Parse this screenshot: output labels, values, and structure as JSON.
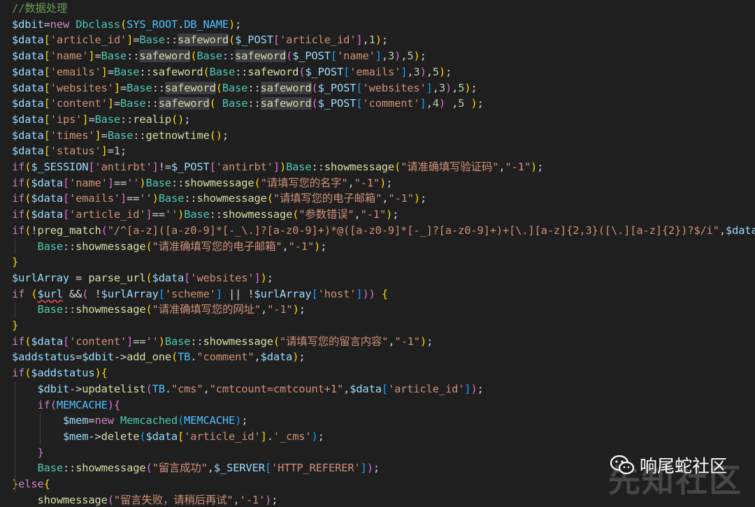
{
  "code_lines": [
    [
      [
        "//数据处理",
        "comment"
      ]
    ],
    [
      [
        "$dbit",
        "var"
      ],
      [
        "=",
        "op"
      ],
      [
        "new ",
        "kw"
      ],
      [
        "Dbclass",
        "class"
      ],
      [
        "(",
        "br1"
      ],
      [
        "SYS_ROOT",
        "const"
      ],
      [
        ".",
        "op"
      ],
      [
        "DB_NAME",
        "const"
      ],
      [
        ")",
        "br1"
      ],
      [
        ";",
        "punc"
      ]
    ],
    [
      [
        "$data",
        "var"
      ],
      [
        "[",
        "br1"
      ],
      [
        "'article_id'",
        "str"
      ],
      [
        "]",
        "br1"
      ],
      [
        "=",
        "op"
      ],
      [
        "Base",
        "class"
      ],
      [
        "::",
        "op"
      ],
      [
        "safeword",
        "fn-hl"
      ],
      [
        "(",
        "br1"
      ],
      [
        "$_POST",
        "var"
      ],
      [
        "[",
        "br2"
      ],
      [
        "'article_id'",
        "str"
      ],
      [
        "]",
        "br2"
      ],
      [
        ",",
        "punc"
      ],
      [
        "1",
        "num"
      ],
      [
        ")",
        "br1"
      ],
      [
        ";",
        "punc"
      ]
    ],
    [
      [
        "$data",
        "var"
      ],
      [
        "[",
        "br1"
      ],
      [
        "'name'",
        "str"
      ],
      [
        "]",
        "br1"
      ],
      [
        "=",
        "op"
      ],
      [
        "Base",
        "class"
      ],
      [
        "::",
        "op"
      ],
      [
        "safeword",
        "fn-hl"
      ],
      [
        "(",
        "br1"
      ],
      [
        "Base",
        "class"
      ],
      [
        "::",
        "op"
      ],
      [
        "safeword",
        "fn-hl"
      ],
      [
        "(",
        "br2"
      ],
      [
        "$_POST",
        "var"
      ],
      [
        "[",
        "br3"
      ],
      [
        "'name'",
        "str"
      ],
      [
        "]",
        "br3"
      ],
      [
        ",",
        "punc"
      ],
      [
        "3",
        "num"
      ],
      [
        ")",
        "br2"
      ],
      [
        ",",
        "punc"
      ],
      [
        "5",
        "num"
      ],
      [
        ")",
        "br1"
      ],
      [
        ";",
        "punc"
      ]
    ],
    [
      [
        "$data",
        "var"
      ],
      [
        "[",
        "br1"
      ],
      [
        "'emails'",
        "str"
      ],
      [
        "]",
        "br1"
      ],
      [
        "=",
        "op"
      ],
      [
        "Base",
        "class"
      ],
      [
        "::",
        "op"
      ],
      [
        "safeword",
        "fn"
      ],
      [
        "(",
        "br1"
      ],
      [
        "Base",
        "class"
      ],
      [
        "::",
        "op"
      ],
      [
        "safeword",
        "fn"
      ],
      [
        "(",
        "br2"
      ],
      [
        "$_POST",
        "var"
      ],
      [
        "[",
        "br3"
      ],
      [
        "'emails'",
        "str"
      ],
      [
        "]",
        "br3"
      ],
      [
        ",",
        "punc"
      ],
      [
        "3",
        "num"
      ],
      [
        ")",
        "br2"
      ],
      [
        ",",
        "punc"
      ],
      [
        "5",
        "num"
      ],
      [
        ")",
        "br1"
      ],
      [
        ";",
        "punc"
      ]
    ],
    [
      [
        "$data",
        "var"
      ],
      [
        "[",
        "br1"
      ],
      [
        "'websites'",
        "str"
      ],
      [
        "]",
        "br1"
      ],
      [
        "=",
        "op"
      ],
      [
        "Base",
        "class"
      ],
      [
        "::",
        "op"
      ],
      [
        "safeword",
        "fn-hl"
      ],
      [
        "(",
        "br1"
      ],
      [
        "Base",
        "class"
      ],
      [
        "::",
        "op"
      ],
      [
        "safeword",
        "fn-hl"
      ],
      [
        "(",
        "br2"
      ],
      [
        "$_POST",
        "var"
      ],
      [
        "[",
        "br3"
      ],
      [
        "'websites'",
        "str"
      ],
      [
        "]",
        "br3"
      ],
      [
        ",",
        "punc"
      ],
      [
        "3",
        "num"
      ],
      [
        ")",
        "br2"
      ],
      [
        ",",
        "punc"
      ],
      [
        "5",
        "num"
      ],
      [
        ")",
        "br1"
      ],
      [
        ";",
        "punc"
      ]
    ],
    [
      [
        "$data",
        "var"
      ],
      [
        "[",
        "br1"
      ],
      [
        "'content'",
        "str"
      ],
      [
        "]",
        "br1"
      ],
      [
        "=",
        "op"
      ],
      [
        "Base",
        "class"
      ],
      [
        "::",
        "op"
      ],
      [
        "safeword",
        "fn-hl"
      ],
      [
        "(",
        "br1"
      ],
      [
        " ",
        "op"
      ],
      [
        "Base",
        "class"
      ],
      [
        "::",
        "op"
      ],
      [
        "safeword",
        "fn-hl"
      ],
      [
        "(",
        "br2"
      ],
      [
        "$_POST",
        "var"
      ],
      [
        "[",
        "br3"
      ],
      [
        "'comment'",
        "str"
      ],
      [
        "]",
        "br3"
      ],
      [
        ",",
        "punc"
      ],
      [
        "4",
        "num"
      ],
      [
        ")",
        "br2"
      ],
      [
        " ,",
        "punc"
      ],
      [
        "5",
        "num"
      ],
      [
        " ",
        "op"
      ],
      [
        ")",
        "br1"
      ],
      [
        ";",
        "punc"
      ]
    ],
    [
      [
        "$data",
        "var"
      ],
      [
        "[",
        "br1"
      ],
      [
        "'ips'",
        "str"
      ],
      [
        "]",
        "br1"
      ],
      [
        "=",
        "op"
      ],
      [
        "Base",
        "class"
      ],
      [
        "::",
        "op"
      ],
      [
        "realip",
        "fn"
      ],
      [
        "()",
        "br1"
      ],
      [
        ";",
        "punc"
      ]
    ],
    [
      [
        "$data",
        "var"
      ],
      [
        "[",
        "br1"
      ],
      [
        "'times'",
        "str"
      ],
      [
        "]",
        "br1"
      ],
      [
        "=",
        "op"
      ],
      [
        "Base",
        "class"
      ],
      [
        "::",
        "op"
      ],
      [
        "getnowtime",
        "fn"
      ],
      [
        "()",
        "br1"
      ],
      [
        ";",
        "punc"
      ]
    ],
    [
      [
        "$data",
        "var"
      ],
      [
        "[",
        "br1"
      ],
      [
        "'status'",
        "str"
      ],
      [
        "]",
        "br1"
      ],
      [
        "=",
        "op"
      ],
      [
        "1",
        "num"
      ],
      [
        ";",
        "punc"
      ]
    ],
    [
      [
        "if",
        "ctrl"
      ],
      [
        "(",
        "br1"
      ],
      [
        "$_SESSION",
        "var"
      ],
      [
        "[",
        "br2"
      ],
      [
        "'antirbt'",
        "str"
      ],
      [
        "]",
        "br2"
      ],
      [
        "!=",
        "op"
      ],
      [
        "$_POST",
        "var"
      ],
      [
        "[",
        "br2"
      ],
      [
        "'antirbt'",
        "str"
      ],
      [
        "]",
        "br2"
      ],
      [
        ")",
        "br1"
      ],
      [
        "Base",
        "class"
      ],
      [
        "::",
        "op"
      ],
      [
        "showmessage",
        "fn"
      ],
      [
        "(",
        "br1"
      ],
      [
        "\"请准确填写验证码\"",
        "str"
      ],
      [
        ",",
        "punc"
      ],
      [
        "\"-1\"",
        "str"
      ],
      [
        ")",
        "br1"
      ],
      [
        ";",
        "punc"
      ]
    ],
    [
      [
        "if",
        "ctrl"
      ],
      [
        "(",
        "br1"
      ],
      [
        "$data",
        "var"
      ],
      [
        "[",
        "br2"
      ],
      [
        "'name'",
        "str"
      ],
      [
        "]",
        "br2"
      ],
      [
        "==",
        "op"
      ],
      [
        "''",
        "str"
      ],
      [
        ")",
        "br1"
      ],
      [
        "Base",
        "class"
      ],
      [
        "::",
        "op"
      ],
      [
        "showmessage",
        "fn"
      ],
      [
        "(",
        "br1"
      ],
      [
        "\"请填写您的名字\"",
        "str"
      ],
      [
        ",",
        "punc"
      ],
      [
        "\"-1\"",
        "str"
      ],
      [
        ")",
        "br1"
      ],
      [
        ";",
        "punc"
      ]
    ],
    [
      [
        "if",
        "ctrl"
      ],
      [
        "(",
        "br1"
      ],
      [
        "$data",
        "var"
      ],
      [
        "[",
        "br2"
      ],
      [
        "'emails'",
        "str"
      ],
      [
        "]",
        "br2"
      ],
      [
        "==",
        "op"
      ],
      [
        "''",
        "str"
      ],
      [
        ")",
        "br1"
      ],
      [
        "Base",
        "class"
      ],
      [
        "::",
        "op"
      ],
      [
        "showmessage",
        "fn"
      ],
      [
        "(",
        "br1"
      ],
      [
        "\"请填写您的电子邮箱\"",
        "str"
      ],
      [
        ",",
        "punc"
      ],
      [
        "\"-1\"",
        "str"
      ],
      [
        ")",
        "br1"
      ],
      [
        ";",
        "punc"
      ]
    ],
    [
      [
        "if",
        "ctrl"
      ],
      [
        "(",
        "br1"
      ],
      [
        "$data",
        "var"
      ],
      [
        "[",
        "br2"
      ],
      [
        "'article_id'",
        "str"
      ],
      [
        "]",
        "br2"
      ],
      [
        "==",
        "op"
      ],
      [
        "''",
        "str"
      ],
      [
        ")",
        "br1"
      ],
      [
        "Base",
        "class"
      ],
      [
        "::",
        "op"
      ],
      [
        "showmessage",
        "fn"
      ],
      [
        "(",
        "br1"
      ],
      [
        "\"参数错误\"",
        "str"
      ],
      [
        ",",
        "punc"
      ],
      [
        "\"-1\"",
        "str"
      ],
      [
        ")",
        "br1"
      ],
      [
        ";",
        "punc"
      ]
    ],
    [
      [
        "if",
        "ctrl"
      ],
      [
        "(",
        "br1"
      ],
      [
        "!",
        "op"
      ],
      [
        "preg_match",
        "fn"
      ],
      [
        "(",
        "br2"
      ],
      [
        "\"/^[a-z]([a-z0-9]*[-_\\.]?[a-z0-9]+)*@([a-z0-9]*[-_]?[a-z0-9]+)+[\\.][a-z]{2,3}([\\.][a-z]{2})?$/i\"",
        "str"
      ],
      [
        ",",
        "punc"
      ],
      [
        "$data",
        "var"
      ]
    ],
    [
      [
        "    ",
        "op"
      ],
      [
        "Base",
        "class"
      ],
      [
        "::",
        "op"
      ],
      [
        "showmessage",
        "fn"
      ],
      [
        "(",
        "br1"
      ],
      [
        "\"请准确填写您的电子邮箱\"",
        "str"
      ],
      [
        ",",
        "punc"
      ],
      [
        "\"-1\"",
        "str"
      ],
      [
        ")",
        "br1"
      ],
      [
        ";",
        "punc"
      ]
    ],
    [
      [
        "}",
        "br1"
      ]
    ],
    [
      [
        "$urlArray",
        "var"
      ],
      [
        " = ",
        "op"
      ],
      [
        "parse_url",
        "fn"
      ],
      [
        "(",
        "br1"
      ],
      [
        "$data",
        "var"
      ],
      [
        "[",
        "br2"
      ],
      [
        "'websites'",
        "str"
      ],
      [
        "]",
        "br2"
      ],
      [
        ")",
        "br1"
      ],
      [
        ";",
        "punc"
      ]
    ],
    [
      [
        "if",
        "ctrl"
      ],
      [
        " (",
        "br1"
      ],
      [
        "$url",
        "var-sq"
      ],
      [
        " &&",
        "op"
      ],
      [
        "( ",
        "br2"
      ],
      [
        "!",
        "op"
      ],
      [
        "$urlArray",
        "var"
      ],
      [
        "[",
        "br3"
      ],
      [
        "'scheme'",
        "str"
      ],
      [
        "]",
        "br3"
      ],
      [
        " || ",
        "op"
      ],
      [
        "!",
        "op"
      ],
      [
        "$urlArray",
        "var"
      ],
      [
        "[",
        "br3"
      ],
      [
        "'host'",
        "str"
      ],
      [
        "]",
        "br3"
      ],
      [
        "))",
        "br2"
      ],
      [
        " {",
        "br1"
      ]
    ],
    [
      [
        "    ",
        "op"
      ],
      [
        "Base",
        "class"
      ],
      [
        "::",
        "op"
      ],
      [
        "showmessage",
        "fn"
      ],
      [
        "(",
        "br1"
      ],
      [
        "\"请准确填写您的网址\"",
        "str"
      ],
      [
        ",",
        "punc"
      ],
      [
        "\"-1\"",
        "str"
      ],
      [
        ")",
        "br1"
      ],
      [
        ";",
        "punc"
      ]
    ],
    [
      [
        "}",
        "br1"
      ]
    ],
    [
      [
        "if",
        "ctrl"
      ],
      [
        "(",
        "br1"
      ],
      [
        "$data",
        "var"
      ],
      [
        "[",
        "br2"
      ],
      [
        "'content'",
        "str"
      ],
      [
        "]",
        "br2"
      ],
      [
        "==",
        "op"
      ],
      [
        "''",
        "str"
      ],
      [
        ")",
        "br1"
      ],
      [
        "Base",
        "class"
      ],
      [
        "::",
        "op"
      ],
      [
        "showmessage",
        "fn"
      ],
      [
        "(",
        "br1"
      ],
      [
        "\"请填写您的留言内容\"",
        "str"
      ],
      [
        ",",
        "punc"
      ],
      [
        "\"-1\"",
        "str"
      ],
      [
        ")",
        "br1"
      ],
      [
        ";",
        "punc"
      ]
    ],
    [
      [
        "$addstatus",
        "var"
      ],
      [
        "=",
        "op"
      ],
      [
        "$dbit",
        "var"
      ],
      [
        "->",
        "op"
      ],
      [
        "add_one",
        "fn"
      ],
      [
        "(",
        "br1"
      ],
      [
        "TB",
        "const"
      ],
      [
        ".",
        "op"
      ],
      [
        "\"comment\"",
        "str"
      ],
      [
        ",",
        "punc"
      ],
      [
        "$data",
        "var"
      ],
      [
        ")",
        "br1"
      ],
      [
        ";",
        "punc"
      ]
    ],
    [
      [
        "if",
        "ctrl"
      ],
      [
        "(",
        "br1"
      ],
      [
        "$addstatus",
        "var"
      ],
      [
        ")",
        "br1"
      ],
      [
        "{",
        "br1"
      ]
    ],
    [
      [
        "    ",
        "op"
      ],
      [
        "$dbit",
        "var"
      ],
      [
        "->",
        "op"
      ],
      [
        "updatelist",
        "fn"
      ],
      [
        "(",
        "br2"
      ],
      [
        "TB",
        "const"
      ],
      [
        ".",
        "op"
      ],
      [
        "\"cms\"",
        "str"
      ],
      [
        ",",
        "punc"
      ],
      [
        "\"cmtcount=cmtcount+1\"",
        "str"
      ],
      [
        ",",
        "punc"
      ],
      [
        "$data",
        "var"
      ],
      [
        "[",
        "br3"
      ],
      [
        "'article_id'",
        "str"
      ],
      [
        "]",
        "br3"
      ],
      [
        ")",
        "br2"
      ],
      [
        ";",
        "punc"
      ]
    ],
    [
      [
        "    ",
        "op"
      ],
      [
        "if",
        "ctrl"
      ],
      [
        "(",
        "br2"
      ],
      [
        "MEMCACHE",
        "const"
      ],
      [
        ")",
        "br2"
      ],
      [
        "{",
        "br2"
      ]
    ],
    [
      [
        "        ",
        "op"
      ],
      [
        "$mem",
        "var"
      ],
      [
        "=",
        "op"
      ],
      [
        "new ",
        "kw"
      ],
      [
        "Memcached",
        "class"
      ],
      [
        "(",
        "br3"
      ],
      [
        "MEMCACHE",
        "const"
      ],
      [
        ")",
        "br3"
      ],
      [
        ";",
        "punc"
      ]
    ],
    [
      [
        "        ",
        "op"
      ],
      [
        "$mem",
        "var"
      ],
      [
        "->",
        "op"
      ],
      [
        "delete",
        "fn"
      ],
      [
        "(",
        "br3"
      ],
      [
        "$data",
        "var"
      ],
      [
        "[",
        "br1"
      ],
      [
        "'article_id'",
        "str"
      ],
      [
        "]",
        "br1"
      ],
      [
        ".",
        "op"
      ],
      [
        "'_cms'",
        "str"
      ],
      [
        ")",
        "br3"
      ],
      [
        ";",
        "punc"
      ]
    ],
    [
      [
        "    ",
        "op"
      ],
      [
        "}",
        "br2"
      ]
    ],
    [
      [
        "    ",
        "op"
      ],
      [
        "Base",
        "class"
      ],
      [
        "::",
        "op"
      ],
      [
        "showmessage",
        "fn"
      ],
      [
        "(",
        "br2"
      ],
      [
        "\"留言成功\"",
        "str"
      ],
      [
        ",",
        "punc"
      ],
      [
        "$_SERVER",
        "var"
      ],
      [
        "[",
        "br3"
      ],
      [
        "'HTTP_REFERER'",
        "str"
      ],
      [
        "]",
        "br3"
      ],
      [
        ")",
        "br2"
      ],
      [
        ";",
        "punc"
      ]
    ],
    [
      [
        "}",
        "br1"
      ],
      [
        "else",
        "ctrl"
      ],
      [
        "{",
        "br1"
      ]
    ],
    [
      [
        "    ",
        "op"
      ],
      [
        "showmessage",
        "fn"
      ],
      [
        "(",
        "br2"
      ],
      [
        "\"留言失败，请稍后再试\"",
        "str"
      ],
      [
        ",",
        "punc"
      ],
      [
        "'-1'",
        "str"
      ],
      [
        ")",
        "br2"
      ],
      [
        ";",
        "punc"
      ]
    ]
  ],
  "watermark": {
    "label": "响尾蛇社区",
    "background_text": "先知社区",
    "icon": "wechat-icon"
  },
  "colors": {
    "background": "#1f1f1f",
    "variable": "#9cdcfe",
    "string": "#ce9178",
    "function": "#dcdcaa",
    "class": "#4ec9b0",
    "keyword": "#c586c0",
    "comment": "#6a9955",
    "number": "#b5cea8"
  }
}
